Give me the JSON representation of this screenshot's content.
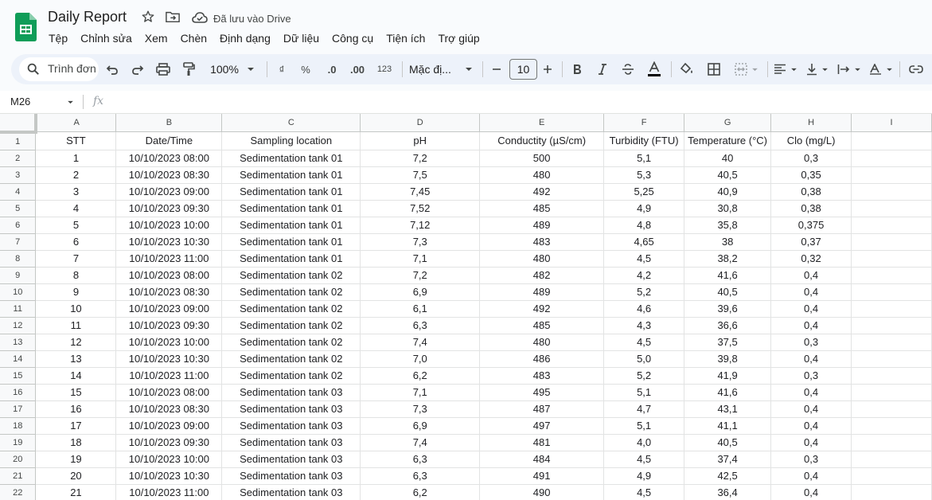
{
  "header": {
    "doc_title": "Daily Report",
    "saved_status": "Đã lưu vào Drive"
  },
  "menu": [
    "Tệp",
    "Chỉnh sửa",
    "Xem",
    "Chèn",
    "Định dạng",
    "Dữ liệu",
    "Công cụ",
    "Tiện ích",
    "Trợ giúp"
  ],
  "toolbar": {
    "search_label": "Trình đơn",
    "zoom": "100%",
    "currency_symbol": "₫",
    "percent_symbol": "%",
    "decrease_decimal": ".0",
    "increase_decimal": ".00",
    "number_format": "123",
    "font_name": "Mặc đị...",
    "font_size": "10"
  },
  "formula_bar": {
    "name_box": "M26",
    "fx_label": "fx"
  },
  "sheet": {
    "column_letters": [
      "A",
      "B",
      "C",
      "D",
      "E",
      "F",
      "G",
      "H",
      "I"
    ],
    "rows": [
      {
        "num": "1",
        "cells": [
          "STT",
          "Date/Time",
          "Sampling location",
          "pH",
          "Conductity (µS/cm)",
          "Turbidity (FTU)",
          "Temperature (°C)",
          "Clo (mg/L)",
          ""
        ]
      },
      {
        "num": "2",
        "cells": [
          "1",
          "10/10/2023 08:00",
          "Sedimentation tank 01",
          "7,2",
          "500",
          "5,1",
          "40",
          "0,3",
          ""
        ]
      },
      {
        "num": "3",
        "cells": [
          "2",
          "10/10/2023 08:30",
          "Sedimentation tank 01",
          "7,5",
          "480",
          "5,3",
          "40,5",
          "0,35",
          ""
        ]
      },
      {
        "num": "4",
        "cells": [
          "3",
          "10/10/2023 09:00",
          "Sedimentation tank 01",
          "7,45",
          "492",
          "5,25",
          "40,9",
          "0,38",
          ""
        ]
      },
      {
        "num": "5",
        "cells": [
          "4",
          "10/10/2023 09:30",
          "Sedimentation tank 01",
          "7,52",
          "485",
          "4,9",
          "30,8",
          "0,38",
          ""
        ]
      },
      {
        "num": "6",
        "cells": [
          "5",
          "10/10/2023 10:00",
          "Sedimentation tank 01",
          "7,12",
          "489",
          "4,8",
          "35,8",
          "0,375",
          ""
        ]
      },
      {
        "num": "7",
        "cells": [
          "6",
          "10/10/2023 10:30",
          "Sedimentation tank 01",
          "7,3",
          "483",
          "4,65",
          "38",
          "0,37",
          ""
        ]
      },
      {
        "num": "8",
        "cells": [
          "7",
          "10/10/2023 11:00",
          "Sedimentation tank 01",
          "7,1",
          "480",
          "4,5",
          "38,2",
          "0,32",
          ""
        ]
      },
      {
        "num": "9",
        "cells": [
          "8",
          "10/10/2023 08:00",
          "Sedimentation tank 02",
          "7,2",
          "482",
          "4,2",
          "41,6",
          "0,4",
          ""
        ]
      },
      {
        "num": "10",
        "cells": [
          "9",
          "10/10/2023 08:30",
          "Sedimentation tank 02",
          "6,9",
          "489",
          "5,2",
          "40,5",
          "0,4",
          ""
        ]
      },
      {
        "num": "11",
        "cells": [
          "10",
          "10/10/2023 09:00",
          "Sedimentation tank 02",
          "6,1",
          "492",
          "4,6",
          "39,6",
          "0,4",
          ""
        ]
      },
      {
        "num": "12",
        "cells": [
          "11",
          "10/10/2023 09:30",
          "Sedimentation tank 02",
          "6,3",
          "485",
          "4,3",
          "36,6",
          "0,4",
          ""
        ]
      },
      {
        "num": "13",
        "cells": [
          "12",
          "10/10/2023 10:00",
          "Sedimentation tank 02",
          "7,4",
          "480",
          "4,5",
          "37,5",
          "0,3",
          ""
        ]
      },
      {
        "num": "14",
        "cells": [
          "13",
          "10/10/2023 10:30",
          "Sedimentation tank 02",
          "7,0",
          "486",
          "5,0",
          "39,8",
          "0,4",
          ""
        ]
      },
      {
        "num": "15",
        "cells": [
          "14",
          "10/10/2023 11:00",
          "Sedimentation tank 02",
          "6,2",
          "483",
          "5,2",
          "41,9",
          "0,3",
          ""
        ]
      },
      {
        "num": "16",
        "cells": [
          "15",
          "10/10/2023 08:00",
          "Sedimentation tank 03",
          "7,1",
          "495",
          "5,1",
          "41,6",
          "0,4",
          ""
        ]
      },
      {
        "num": "17",
        "cells": [
          "16",
          "10/10/2023 08:30",
          "Sedimentation tank 03",
          "7,3",
          "487",
          "4,7",
          "43,1",
          "0,4",
          ""
        ]
      },
      {
        "num": "18",
        "cells": [
          "17",
          "10/10/2023 09:00",
          "Sedimentation tank 03",
          "6,9",
          "497",
          "5,1",
          "41,1",
          "0,4",
          ""
        ]
      },
      {
        "num": "19",
        "cells": [
          "18",
          "10/10/2023 09:30",
          "Sedimentation tank 03",
          "7,4",
          "481",
          "4,0",
          "40,5",
          "0,4",
          ""
        ]
      },
      {
        "num": "20",
        "cells": [
          "19",
          "10/10/2023 10:00",
          "Sedimentation tank 03",
          "6,3",
          "484",
          "4,5",
          "37,4",
          "0,3",
          ""
        ]
      },
      {
        "num": "21",
        "cells": [
          "20",
          "10/10/2023 10:30",
          "Sedimentation tank 03",
          "6,3",
          "491",
          "4,9",
          "42,5",
          "0,4",
          ""
        ]
      },
      {
        "num": "22",
        "cells": [
          "21",
          "10/10/2023 11:00",
          "Sedimentation tank 03",
          "6,2",
          "490",
          "4,5",
          "36,4",
          "0,4",
          ""
        ]
      }
    ]
  }
}
